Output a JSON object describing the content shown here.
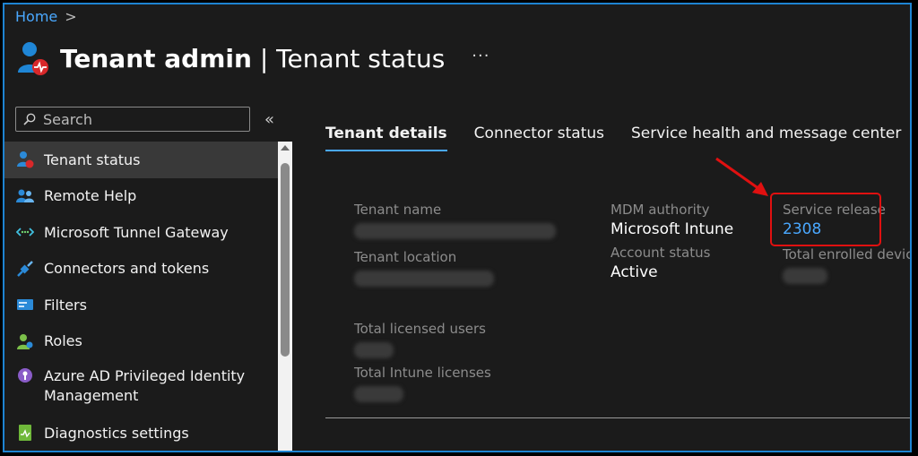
{
  "breadcrumb": {
    "home": "Home",
    "separator": ">"
  },
  "header": {
    "title_bold": "Tenant admin",
    "title_rest": " | Tenant status",
    "more": "···"
  },
  "search": {
    "placeholder": "Search"
  },
  "collapse_label": "«",
  "sidebar": {
    "items": [
      {
        "label": "Tenant status",
        "icon": "tenant-status-icon",
        "active": true
      },
      {
        "label": "Remote Help",
        "icon": "remote-help-icon"
      },
      {
        "label": "Microsoft Tunnel Gateway",
        "icon": "tunnel-gateway-icon"
      },
      {
        "label": "Connectors and tokens",
        "icon": "connectors-icon"
      },
      {
        "label": "Filters",
        "icon": "filters-icon"
      },
      {
        "label": "Roles",
        "icon": "roles-icon"
      },
      {
        "label": "Azure AD Privileged Identity Management",
        "icon": "pim-icon"
      },
      {
        "label": "Diagnostics settings",
        "icon": "diagnostics-icon"
      }
    ]
  },
  "tabs": [
    {
      "label": "Tenant details",
      "active": true
    },
    {
      "label": "Connector status"
    },
    {
      "label": "Service health and message center"
    }
  ],
  "details": {
    "tenant_name_label": "Tenant name",
    "tenant_location_label": "Tenant location",
    "total_licensed_users_label": "Total licensed users",
    "total_intune_licenses_label": "Total Intune licenses",
    "mdm_authority_label": "MDM authority",
    "mdm_authority_value": "Microsoft Intune",
    "account_status_label": "Account status",
    "account_status_value": "Active",
    "service_release_label": "Service release",
    "service_release_value": "2308",
    "total_enrolled_devices_label": "Total enrolled devices"
  },
  "colors": {
    "accent": "#4aa8ff",
    "frame_border": "#1e84d2",
    "highlight": "#e01010",
    "background": "#1b1b1b"
  }
}
